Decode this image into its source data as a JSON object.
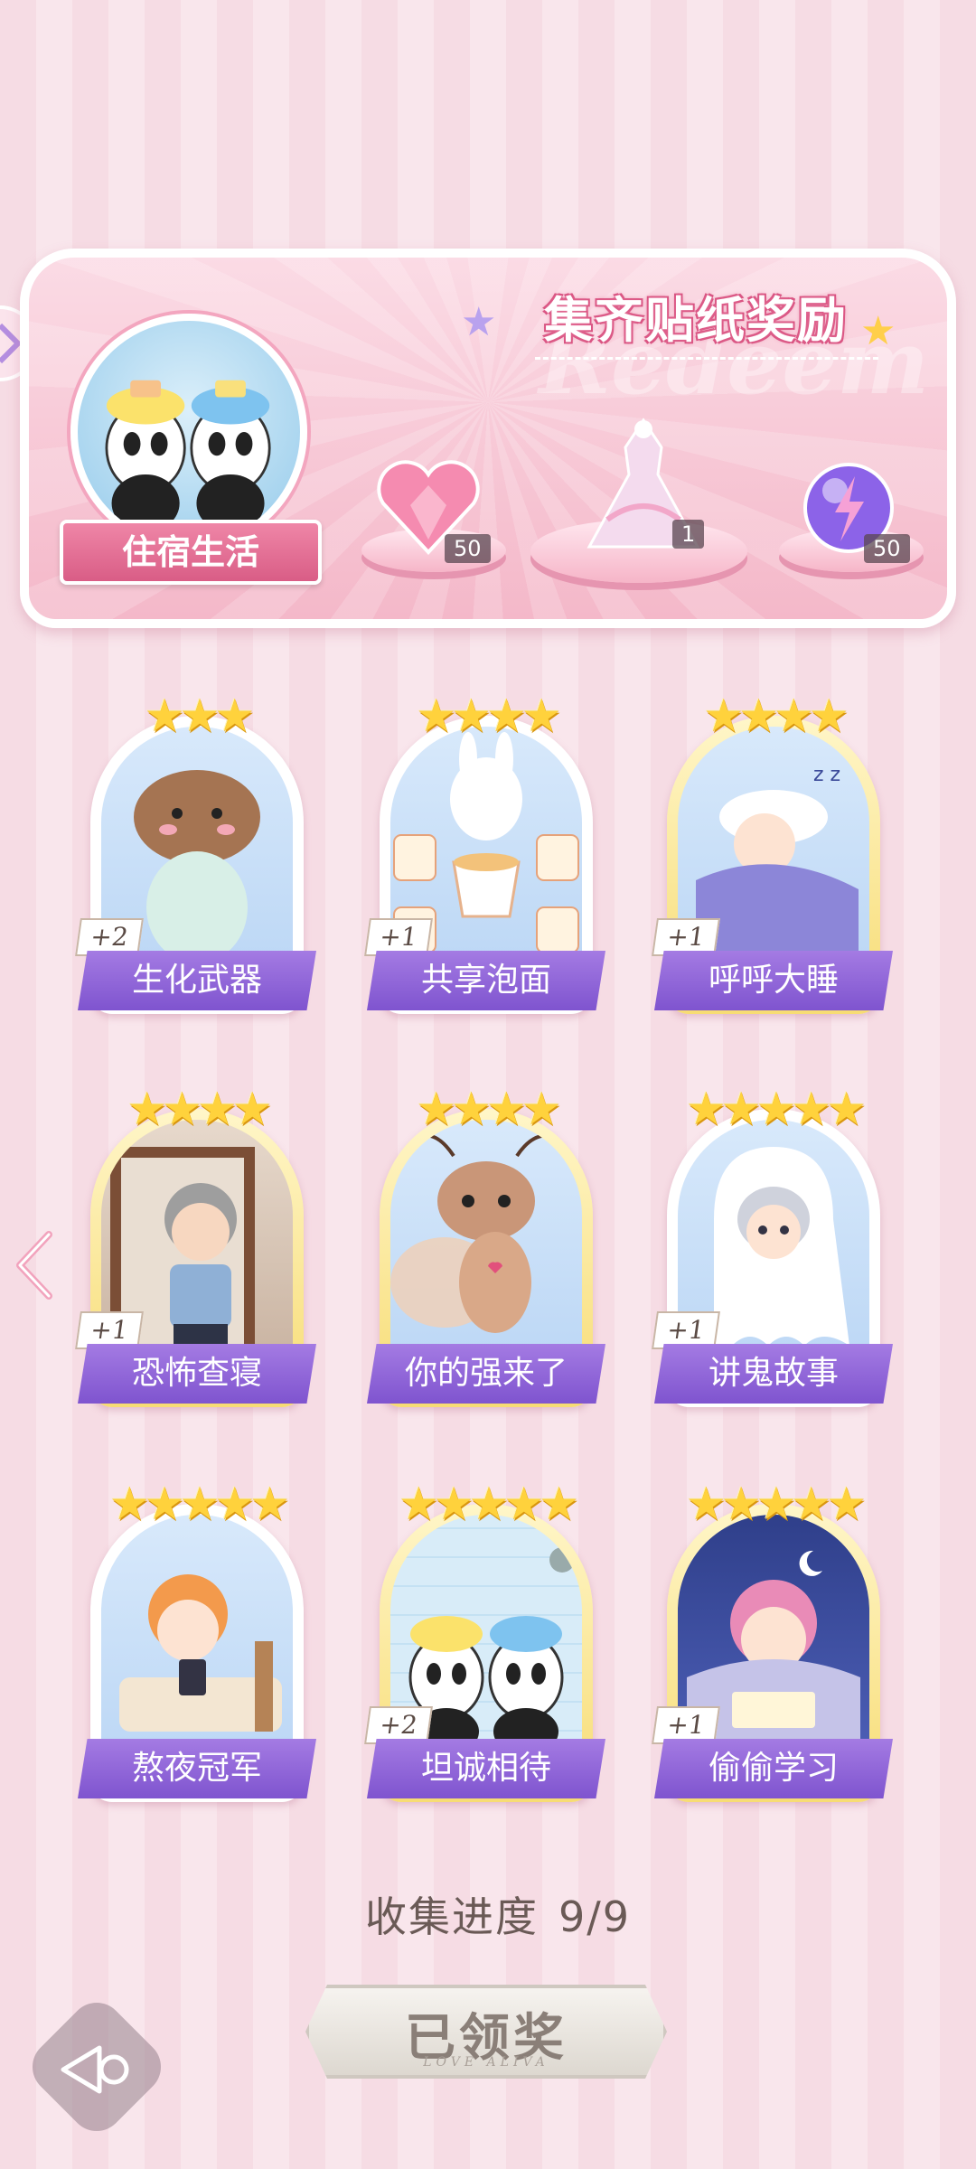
{
  "banner": {
    "title": "集齐贴纸奖励",
    "watermark": "Redeem",
    "theme_label": "住宿生活",
    "rewards": [
      {
        "name": "pink-heart-gem",
        "count": "50"
      },
      {
        "name": "pink-dress-outfit",
        "count": "1"
      },
      {
        "name": "purple-lightning-orb",
        "count": "50"
      }
    ]
  },
  "stickers": [
    {
      "name": "生化武器",
      "plus": "+2",
      "stars": "★★★"
    },
    {
      "name": "共享泡面",
      "plus": "+1",
      "stars": "★★★★"
    },
    {
      "name": "呼呼大睡",
      "plus": "+1",
      "stars": "★★★★"
    },
    {
      "name": "恐怖查寝",
      "plus": "+1",
      "stars": "★★★★"
    },
    {
      "name": "你的强来了",
      "plus": "",
      "stars": "★★★★"
    },
    {
      "name": "讲鬼故事",
      "plus": "+1",
      "stars": "★★★★★"
    },
    {
      "name": "熬夜冠军",
      "plus": "",
      "stars": "★★★★★"
    },
    {
      "name": "坦诚相待",
      "plus": "+2",
      "stars": "★★★★★"
    },
    {
      "name": "偷偷学习",
      "plus": "+1",
      "stars": "★★★★★"
    }
  ],
  "progress": {
    "label": "收集进度",
    "value": "9/9"
  },
  "claim_button": {
    "label": "已领奖",
    "sub": "LOVE ALIVA"
  },
  "colors": {
    "accent": "#d95d86",
    "label_purple": "#8e62d8",
    "star_gold": "#ffd23c"
  }
}
